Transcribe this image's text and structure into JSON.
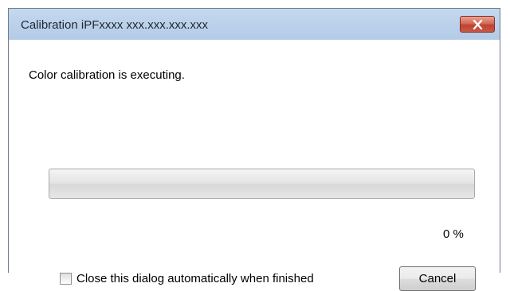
{
  "window": {
    "title": "Calibration iPFxxxx xxx.xxx.xxx.xxx",
    "close_icon": "close-icon"
  },
  "dialog": {
    "message": "Color calibration is executing.",
    "progress": {
      "fraction": 0,
      "percent_text": "0 %",
      "fill_color": "#3fbf2a"
    },
    "checkbox": {
      "label": "Close this dialog automatically when finished",
      "checked": false
    },
    "cancel_label": "Cancel"
  },
  "colors": {
    "titlebar": "#b9cfe9",
    "close_button": "#c7594a"
  }
}
